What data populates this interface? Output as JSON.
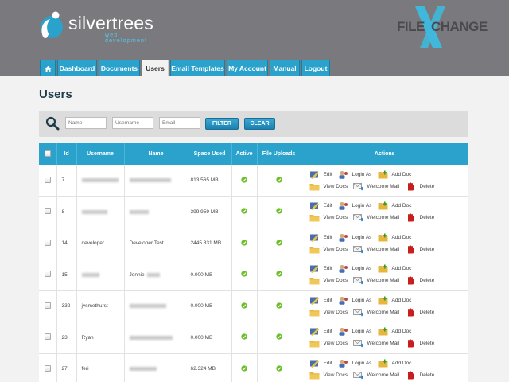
{
  "brand": {
    "name": "silvertrees",
    "tagline": "web development",
    "partner_left": "FILE",
    "partner_right": "CHANGE"
  },
  "nav": {
    "tabs": [
      {
        "label": "Dashboard"
      },
      {
        "label": "Documents"
      },
      {
        "label": "Users"
      },
      {
        "label": "Email Templates"
      },
      {
        "label": "My Account"
      },
      {
        "label": "Manual"
      },
      {
        "label": "Logout"
      }
    ],
    "active": "Users"
  },
  "page": {
    "title": "Users"
  },
  "filter": {
    "name_placeholder": "Name",
    "username_placeholder": "Username",
    "email_placeholder": "Email",
    "filter_label": "FILTER",
    "clear_label": "CLEAR"
  },
  "table": {
    "headers": [
      "Id",
      "Username",
      "Name",
      "Space Used",
      "Active",
      "File Uploads",
      "Actions"
    ],
    "action_labels": {
      "edit": "Edit",
      "login_as": "Login As",
      "add_doc": "Add Doc",
      "view_docs": "View Docs",
      "welcome_mail": "Welcome Mail",
      "delete": "Delete"
    },
    "rows": [
      {
        "id": "7",
        "username": "",
        "name": "",
        "space_used": "813.565 MB"
      },
      {
        "id": "8",
        "username": "",
        "name": "",
        "space_used": "399.959 MB"
      },
      {
        "id": "14",
        "username": "developer",
        "name": "Developer Test",
        "space_used": "2445.831 MB"
      },
      {
        "id": "15",
        "username": "",
        "name": "Jennie",
        "space_used": "0.000 MB"
      },
      {
        "id": "332",
        "username": "jvsmethurst",
        "name": "",
        "space_used": "0.000 MB"
      },
      {
        "id": "23",
        "username": "Ryan",
        "name": "",
        "space_used": "0.000 MB"
      },
      {
        "id": "27",
        "username": "feri",
        "name": "",
        "space_used": "62.324 MB"
      }
    ]
  },
  "colors": {
    "accent": "#2aa2cc",
    "header_bg": "#7a7a7e",
    "active_ok": "#6cbf2a",
    "delete_red": "#c81e1e"
  }
}
